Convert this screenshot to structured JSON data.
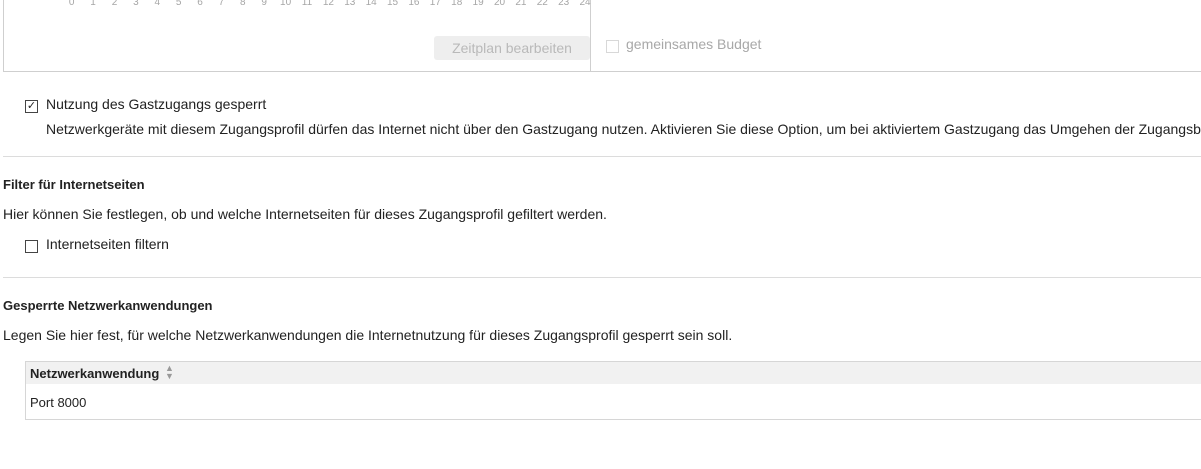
{
  "schedule": {
    "hours": [
      "0",
      "1",
      "2",
      "3",
      "4",
      "5",
      "6",
      "7",
      "8",
      "9",
      "10",
      "11",
      "12",
      "13",
      "14",
      "15",
      "16",
      "17",
      "18",
      "19",
      "20",
      "21",
      "22",
      "23",
      "24"
    ],
    "edit_button_label": "Zeitplan bearbeiten",
    "shared_budget_label": "gemeinsames Budget",
    "shared_budget_checked": false
  },
  "guest_access": {
    "checked": true,
    "check_glyph": "✓",
    "label": "Nutzung des Gastzugangs gesperrt",
    "description": "Netzwerkgeräte mit diesem Zugangsprofil dürfen das Internet nicht über den Gastzugang nutzen. Aktivieren Sie diese Option, um bei aktiviertem Gastzugang das Umgehen der Zugangsbe"
  },
  "web_filter": {
    "heading": "Filter für Internetseiten",
    "description": "Hier können Sie festlegen, ob und welche Internetseiten für dieses Zugangsprofil gefiltert werden.",
    "checkbox_label": "Internetseiten filtern",
    "checked": false
  },
  "blocked_apps": {
    "heading": "Gesperrte Netzwerkanwendungen",
    "description": "Legen Sie hier fest, für welche Netzwerkanwendungen die Internetnutzung für dieses Zugangsprofil gesperrt sein soll.",
    "column_header": "Netzwerkanwendung",
    "sort_icon": "sort-icon",
    "rows": [
      "Port 8000"
    ]
  }
}
